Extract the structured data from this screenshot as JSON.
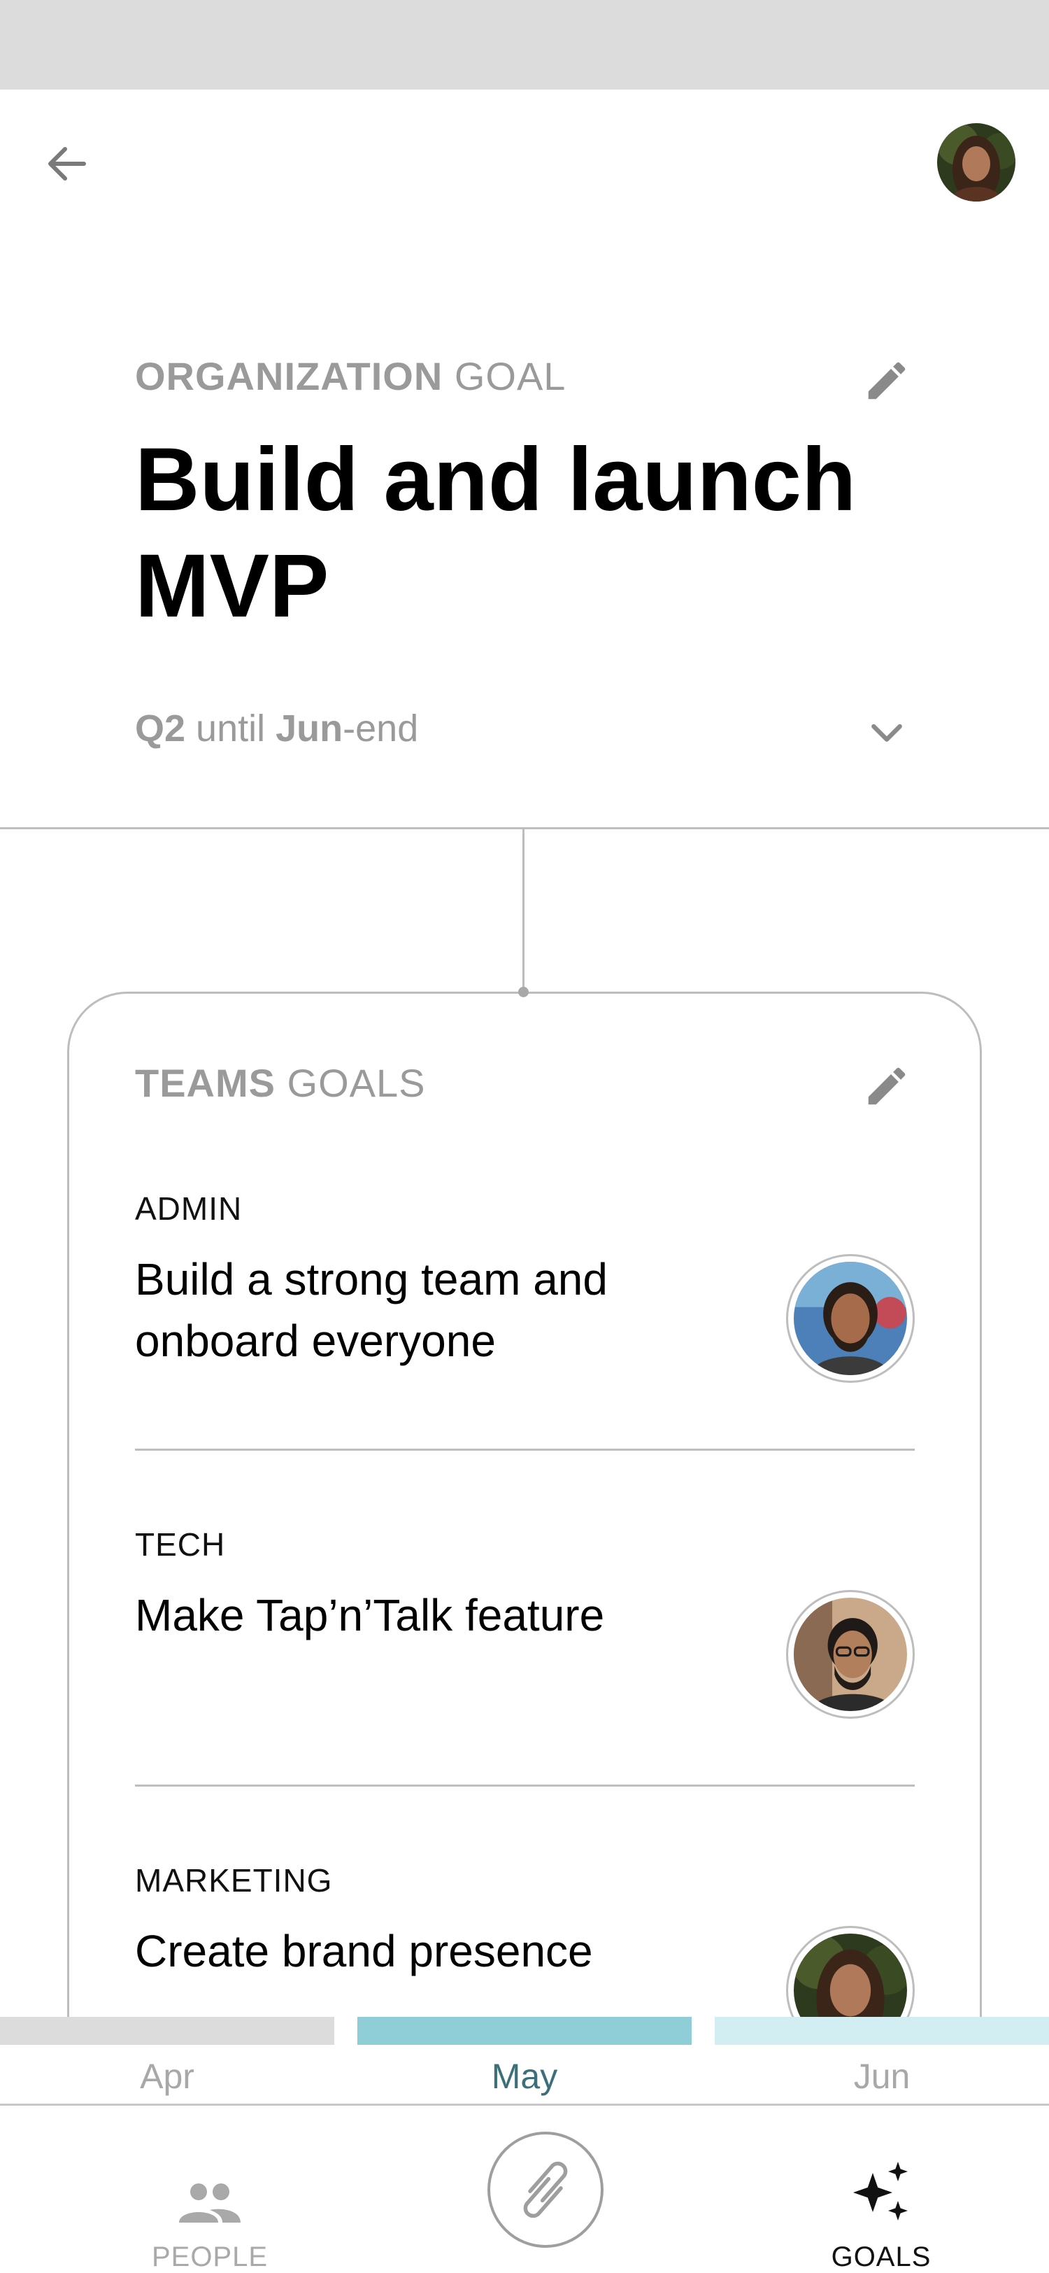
{
  "header": {
    "back_icon": "arrow-left-icon"
  },
  "org_goal": {
    "label_bold": "ORGANIZATION",
    "label_rest": " GOAL",
    "title": "Build and launch MVP",
    "period_quarter": "Q2",
    "period_until": " until ",
    "period_month": "Jun",
    "period_suffix": "-end",
    "edit_icon": "pencil-icon",
    "expand_icon": "chevron-down-icon"
  },
  "teams": {
    "label_bold": "TEAMS",
    "label_rest": " GOALS",
    "edit_icon": "pencil-icon",
    "items": [
      {
        "team": "ADMIN",
        "goal": "Build a strong team and onboard everyone"
      },
      {
        "team": "TECH",
        "goal": "Make Tap’n’Talk feature"
      },
      {
        "team": "MARKETING",
        "goal": "Create brand presence"
      }
    ]
  },
  "timeline": {
    "months": [
      {
        "label": "Apr",
        "bar_color": "#dcdcdc",
        "text_color": "#a8a8a8"
      },
      {
        "label": "May",
        "bar_color": "#8fcdd7",
        "text_color": "#3d6f7a"
      },
      {
        "label": "Jun",
        "bar_color": "#d2eef2",
        "text_color": "#a8a8a8"
      }
    ],
    "active": "May"
  },
  "bottom_nav": {
    "items": [
      {
        "label": "PEOPLE",
        "icon": "people-icon"
      },
      {
        "label": "GOALS",
        "icon": "sparkles-icon"
      }
    ],
    "home_icon": "app-logo-icon"
  }
}
